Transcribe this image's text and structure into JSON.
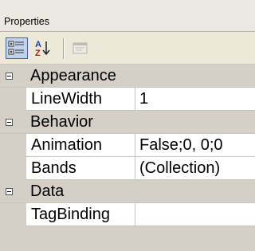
{
  "panel": {
    "title": "Properties"
  },
  "toolbar": {
    "buttons": [
      {
        "icon": "categorized-icon",
        "pressed": true
      },
      {
        "icon": "alphabetical-sort-icon",
        "pressed": false
      },
      {
        "icon": "property-pages-icon",
        "enabled": false
      }
    ],
    "alpha_top": "A",
    "alpha_bottom": "Z"
  },
  "grid": {
    "categories": [
      {
        "name": "Appearance",
        "expanded": true,
        "properties": [
          {
            "name": "LineWidth",
            "value": "1"
          }
        ]
      },
      {
        "name": "Behavior",
        "expanded": true,
        "properties": [
          {
            "name": "Animation",
            "value": "False;0, 0;0"
          },
          {
            "name": "Bands",
            "value": "(Collection)"
          }
        ]
      },
      {
        "name": "Data",
        "expanded": true,
        "properties": [
          {
            "name": "TagBinding",
            "value": ""
          }
        ]
      }
    ]
  },
  "colors": {
    "selection_border": "#316ac5",
    "selection_fill": "#c1d2ee",
    "grid_background": "#d4d0c8",
    "cell_background": "#ffffff"
  }
}
